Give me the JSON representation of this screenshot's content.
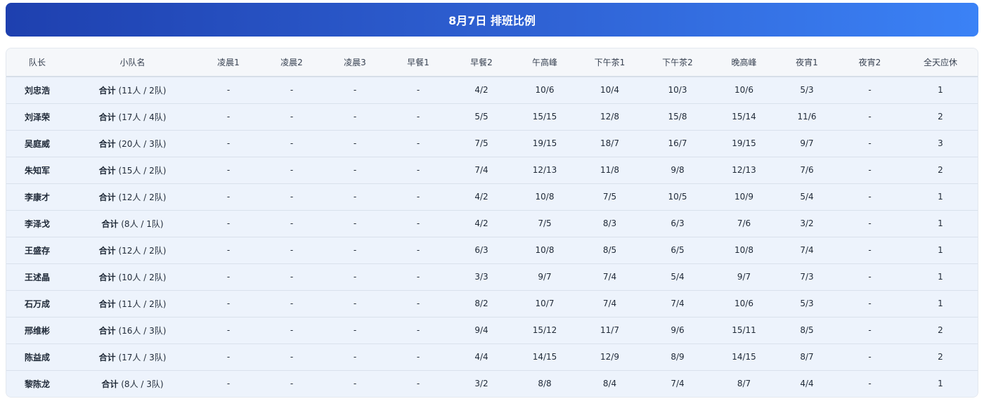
{
  "title": "8月7日 排班比例",
  "columns": [
    "队长",
    "小队名",
    "凌晨1",
    "凌晨2",
    "凌晨3",
    "早餐1",
    "早餐2",
    "午高峰",
    "下午茶1",
    "下午茶2",
    "晚高峰",
    "夜宵1",
    "夜宵2",
    "全天应休"
  ],
  "rows": [
    {
      "leader": "刘忠浩",
      "team_label": "合计",
      "team_count": " (11人 / 2队)",
      "cells": [
        "-",
        "-",
        "-",
        "-",
        "4/2",
        "10/6",
        "10/4",
        "10/3",
        "10/6",
        "5/3",
        "-",
        "1"
      ]
    },
    {
      "leader": "刘泽荣",
      "team_label": "合计",
      "team_count": " (17人 / 4队)",
      "cells": [
        "-",
        "-",
        "-",
        "-",
        "5/5",
        "15/15",
        "12/8",
        "15/8",
        "15/14",
        "11/6",
        "-",
        "2"
      ]
    },
    {
      "leader": "吴庭威",
      "team_label": "合计",
      "team_count": " (20人 / 3队)",
      "cells": [
        "-",
        "-",
        "-",
        "-",
        "7/5",
        "19/15",
        "18/7",
        "16/7",
        "19/15",
        "9/7",
        "-",
        "3"
      ]
    },
    {
      "leader": "朱知军",
      "team_label": "合计",
      "team_count": " (15人 / 2队)",
      "cells": [
        "-",
        "-",
        "-",
        "-",
        "7/4",
        "12/13",
        "11/8",
        "9/8",
        "12/13",
        "7/6",
        "-",
        "2"
      ]
    },
    {
      "leader": "李康才",
      "team_label": "合计",
      "team_count": " (12人 / 2队)",
      "cells": [
        "-",
        "-",
        "-",
        "-",
        "4/2",
        "10/8",
        "7/5",
        "10/5",
        "10/9",
        "5/4",
        "-",
        "1"
      ]
    },
    {
      "leader": "李泽戈",
      "team_label": "合计",
      "team_count": " (8人 / 1队)",
      "cells": [
        "-",
        "-",
        "-",
        "-",
        "4/2",
        "7/5",
        "8/3",
        "6/3",
        "7/6",
        "3/2",
        "-",
        "1"
      ]
    },
    {
      "leader": "王盛存",
      "team_label": "合计",
      "team_count": " (12人 / 2队)",
      "cells": [
        "-",
        "-",
        "-",
        "-",
        "6/3",
        "10/8",
        "8/5",
        "6/5",
        "10/8",
        "7/4",
        "-",
        "1"
      ]
    },
    {
      "leader": "王述晶",
      "team_label": "合计",
      "team_count": " (10人 / 2队)",
      "cells": [
        "-",
        "-",
        "-",
        "-",
        "3/3",
        "9/7",
        "7/4",
        "5/4",
        "9/7",
        "7/3",
        "-",
        "1"
      ]
    },
    {
      "leader": "石万成",
      "team_label": "合计",
      "team_count": " (11人 / 2队)",
      "cells": [
        "-",
        "-",
        "-",
        "-",
        "8/2",
        "10/7",
        "7/4",
        "7/4",
        "10/6",
        "5/3",
        "-",
        "1"
      ]
    },
    {
      "leader": "邢维彬",
      "team_label": "合计",
      "team_count": " (16人 / 3队)",
      "cells": [
        "-",
        "-",
        "-",
        "-",
        "9/4",
        "15/12",
        "11/7",
        "9/6",
        "15/11",
        "8/5",
        "-",
        "2"
      ]
    },
    {
      "leader": "陈益成",
      "team_label": "合计",
      "team_count": " (17人 / 3队)",
      "cells": [
        "-",
        "-",
        "-",
        "-",
        "4/4",
        "14/15",
        "12/9",
        "8/9",
        "14/15",
        "8/7",
        "-",
        "2"
      ]
    },
    {
      "leader": "黎陈龙",
      "team_label": "合计",
      "team_count": " (8人 / 3队)",
      "cells": [
        "-",
        "-",
        "-",
        "-",
        "3/2",
        "8/8",
        "8/4",
        "7/4",
        "8/7",
        "4/4",
        "-",
        "1"
      ]
    }
  ]
}
